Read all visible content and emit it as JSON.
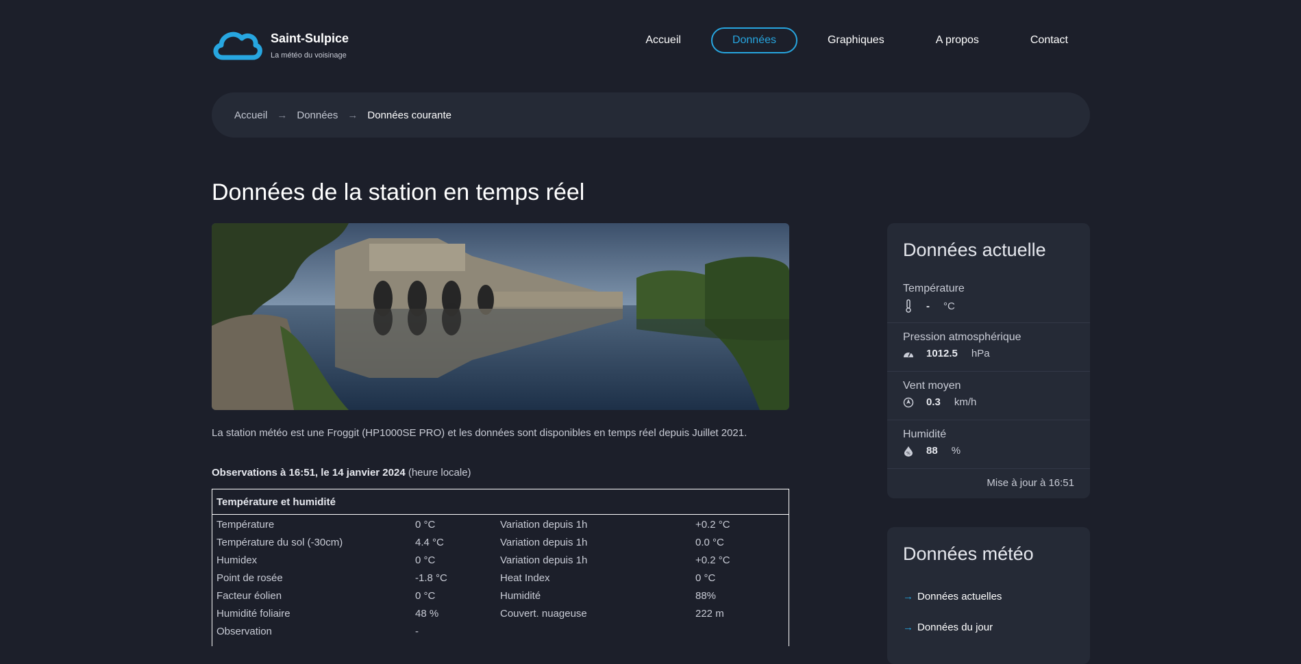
{
  "header": {
    "brand_name": "Saint-Sulpice",
    "brand_sub": "La météo du voisinage",
    "nav": [
      {
        "label": "Accueil",
        "active": false
      },
      {
        "label": "Données",
        "active": true
      },
      {
        "label": "Graphiques",
        "active": false
      },
      {
        "label": "A propos",
        "active": false
      },
      {
        "label": "Contact",
        "active": false
      }
    ]
  },
  "breadcrumb": {
    "items": [
      "Accueil",
      "Données"
    ],
    "current": "Données courante",
    "separator": "→"
  },
  "page_title": "Données de la station en temps réel",
  "intro": "La station météo est une Froggit (HP1000SE PRO) et les données sont disponibles en temps réel depuis Juillet 2021.",
  "observations": {
    "bold": "Observations à 16:51, le 14 janvier 2024",
    "suffix": " (heure locale)"
  },
  "table": {
    "title": "Température et humidité",
    "rows": [
      [
        "Température",
        "0 °C",
        "Variation depuis 1h",
        "+0.2 °C"
      ],
      [
        "Température du sol (-30cm)",
        "4.4 °C",
        "Variation depuis 1h",
        "0.0 °C"
      ],
      [
        "Humidex",
        "0 °C",
        "Variation depuis 1h",
        "+0.2 °C"
      ],
      [
        "Point de rosée",
        "-1.8 °C",
        "Heat Index",
        "0 °C"
      ],
      [
        "Facteur éolien",
        "0 °C",
        "Humidité",
        "88%"
      ],
      [
        "Humidité foliaire",
        "48 %",
        "Couvert. nuageuse",
        "222 m"
      ],
      [
        "Observation",
        "-",
        "",
        ""
      ]
    ]
  },
  "current_card": {
    "title": "Données actuelle",
    "metrics": [
      {
        "label": "Température",
        "value": "-",
        "unit": "°C",
        "icon": "thermometer-icon"
      },
      {
        "label": "Pression atmosphérique",
        "value": "1012.5",
        "unit": "hPa",
        "icon": "gauge-icon"
      },
      {
        "label": "Vent moyen",
        "value": "0.3",
        "unit": "km/h",
        "icon": "wind-icon"
      },
      {
        "label": "Humidité",
        "value": "88",
        "unit": "%",
        "icon": "humidity-icon"
      }
    ],
    "update": "Mise à jour à 16:51"
  },
  "meteo_card": {
    "title": "Données météo",
    "links": [
      "Données actuelles",
      "Données du jour"
    ]
  },
  "colors": {
    "accent": "#27a6e0",
    "background": "#1c1f2a",
    "card": "#252a36"
  }
}
